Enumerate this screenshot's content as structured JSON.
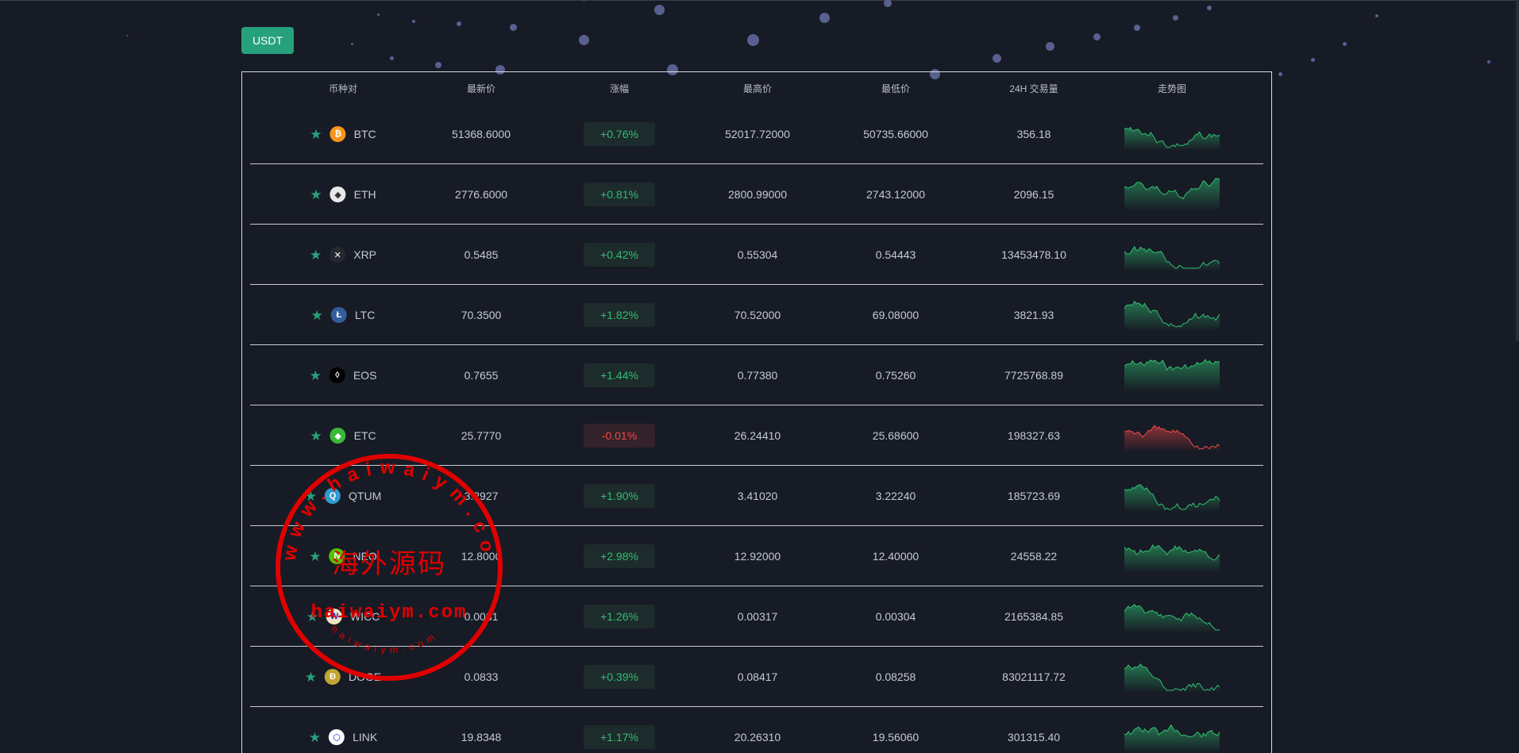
{
  "quote_tab": {
    "label": "USDT"
  },
  "table": {
    "headers": [
      "币种对",
      "最新价",
      "涨幅",
      "最高价",
      "最低价",
      "24H 交易量",
      "走势图"
    ],
    "rows": [
      {
        "symbol": "BTC",
        "icon": "bitcoin-icon",
        "icon_color": "#f7931a",
        "icon_glyph": "₿",
        "price": "51368.6000",
        "change": "+0.76%",
        "dir": "up",
        "high": "52017.72000",
        "low": "50735.66000",
        "volume": "356.18"
      },
      {
        "symbol": "ETH",
        "icon": "ethereum-icon",
        "icon_color": "#e8e8e8",
        "icon_glyph": "◆",
        "price": "2776.6000",
        "change": "+0.81%",
        "dir": "up",
        "high": "2800.99000",
        "low": "2743.12000",
        "volume": "2096.15"
      },
      {
        "symbol": "XRP",
        "icon": "ripple-icon",
        "icon_color": "#23292f",
        "icon_glyph": "✕",
        "price": "0.5485",
        "change": "+0.42%",
        "dir": "up",
        "high": "0.55304",
        "low": "0.54443",
        "volume": "13453478.10"
      },
      {
        "symbol": "LTC",
        "icon": "litecoin-icon",
        "icon_color": "#345d9d",
        "icon_glyph": "Ł",
        "price": "70.3500",
        "change": "+1.82%",
        "dir": "up",
        "high": "70.52000",
        "low": "69.08000",
        "volume": "3821.93"
      },
      {
        "symbol": "EOS",
        "icon": "eos-icon",
        "icon_color": "#000000",
        "icon_glyph": "◊",
        "price": "0.7655",
        "change": "+1.44%",
        "dir": "up",
        "high": "0.77380",
        "low": "0.75260",
        "volume": "7725768.89"
      },
      {
        "symbol": "ETC",
        "icon": "ethereum-classic-icon",
        "icon_color": "#3ab83a",
        "icon_glyph": "◆",
        "price": "25.7770",
        "change": "-0.01%",
        "dir": "down",
        "high": "26.24410",
        "low": "25.68600",
        "volume": "198327.63"
      },
      {
        "symbol": "QTUM",
        "icon": "qtum-icon",
        "icon_color": "#2e9ad0",
        "icon_glyph": "Q",
        "price": "3.2927",
        "change": "+1.90%",
        "dir": "up",
        "high": "3.41020",
        "low": "3.22240",
        "volume": "185723.69"
      },
      {
        "symbol": "NEO",
        "icon": "neo-icon",
        "icon_color": "#58bf00",
        "icon_glyph": "N",
        "price": "12.8000",
        "change": "+2.98%",
        "dir": "up",
        "high": "12.92000",
        "low": "12.40000",
        "volume": "24558.22"
      },
      {
        "symbol": "WICC",
        "icon": "waykichain-icon",
        "icon_color": "#f3e3c4",
        "icon_glyph": "W",
        "price": "0.0031",
        "change": "+1.26%",
        "dir": "up",
        "high": "0.00317",
        "low": "0.00304",
        "volume": "2165384.85"
      },
      {
        "symbol": "DOGE",
        "icon": "dogecoin-icon",
        "icon_color": "#c2a633",
        "icon_glyph": "Ð",
        "price": "0.0833",
        "change": "+0.39%",
        "dir": "up",
        "high": "0.08417",
        "low": "0.08258",
        "volume": "83021117.72"
      },
      {
        "symbol": "LINK",
        "icon": "chainlink-icon",
        "icon_color": "#ffffff",
        "icon_glyph": "⬡",
        "price": "19.8348",
        "change": "+1.17%",
        "dir": "up",
        "high": "20.26310",
        "low": "19.56060",
        "volume": "301315.40"
      }
    ]
  },
  "colors": {
    "up": "#2fbf71",
    "down": "#ee4848",
    "accent": "#26a17b",
    "background": "#171b25"
  },
  "watermark": {
    "ring_text": "www.haiwaiym.com",
    "center_text": "海外源码",
    "domain_text": "haiwaiym.com",
    "small_text": "haiwaiym.com"
  }
}
